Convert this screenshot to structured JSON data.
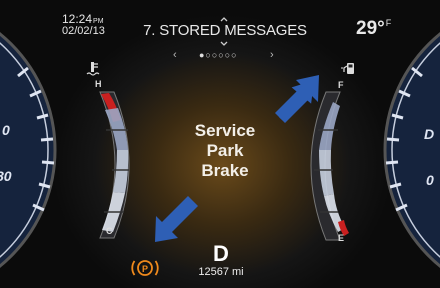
{
  "status": {
    "time": "12:24",
    "ampm": "PM",
    "date": "02/02/13",
    "temperature": "29°",
    "temp_unit": "F"
  },
  "menu": {
    "title": "7. STORED MESSAGES",
    "page_dots": "●○○○○○",
    "arrow_up_icon": "chevron-up-icon",
    "arrow_down_icon": "chevron-down-icon",
    "left_arrow": "‹",
    "right_arrow": "›"
  },
  "message": {
    "line1": "Service",
    "line2": "Park",
    "line3": "Brake"
  },
  "drive": {
    "gear": "D",
    "odometer": "12567 mi"
  },
  "gauges": {
    "coolant": {
      "high_label": "H",
      "low_label": "C",
      "icon": "coolant-temperature-icon"
    },
    "fuel": {
      "full_label": "F",
      "empty_label": "E",
      "icon": "fuel-pump-icon"
    }
  },
  "speedometer_scale": {
    "left_top": "0",
    "left_mid": "80",
    "right_top": "D",
    "right_mid": "0"
  },
  "indicators": {
    "park_brake_icon": "park-brake-warning-icon",
    "park_brake_color": "#f08a1c"
  },
  "callouts": {
    "arrow_color": "#2e5fb5"
  }
}
